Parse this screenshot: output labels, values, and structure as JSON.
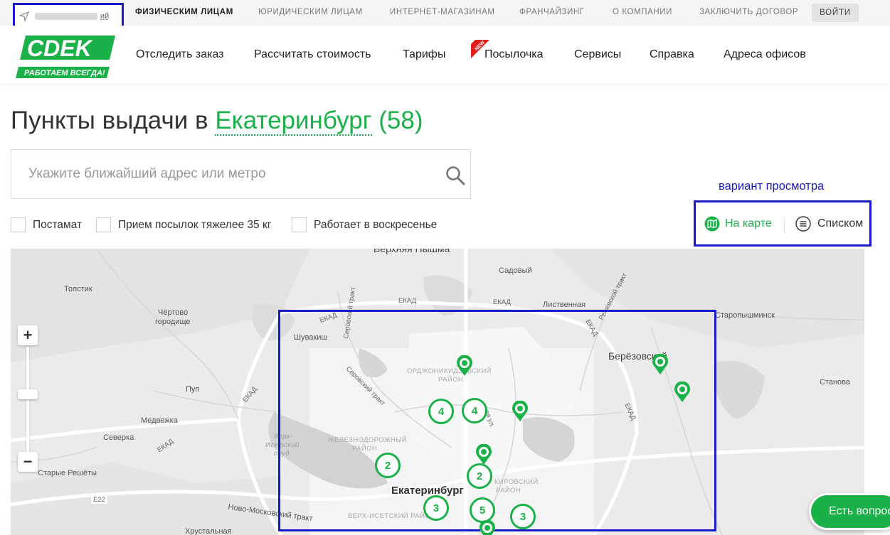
{
  "topbar": {
    "city_suffix": "ий",
    "nav": [
      "ФИЗИЧЕСКИМ ЛИЦАМ",
      "ЮРИДИЧЕСКИМ ЛИЦАМ",
      "ИНТЕРНЕТ-МАГАЗИНАМ",
      "ФРАНЧАЙЗИНГ",
      "О КОМПАНИИ",
      "ЗАКЛЮЧИТЬ ДОГОВОР"
    ],
    "login": "ВОЙТИ"
  },
  "logo": {
    "brand": "CDEK",
    "slogan": "РАБОТАЕМ ВСЕГДА!"
  },
  "main_nav": [
    "Отследить заказ",
    "Рассчитать стоимость",
    "Тарифы",
    "Посылочка",
    "Сервисы",
    "Справка",
    "Адреса офисов"
  ],
  "new_badge": "NEW",
  "page": {
    "title_prefix": "Пункты выдачи в",
    "city": "Екатеринбург",
    "count": "(58)"
  },
  "search": {
    "placeholder": "Укажите ближайший адрес или метро"
  },
  "filters": [
    "Постамат",
    "Прием посылок тяжелее 35 кг",
    "Работает в воскресенье"
  ],
  "view": {
    "label": "вариант просмотра",
    "map": "На карте",
    "list": "Списком"
  },
  "map": {
    "labels": {
      "verkhnyaya_pyshma": "Верхняя Пышма",
      "sadovy": "Садовый",
      "tolstik": "Толстик",
      "chertovo": "Чёртово",
      "gorodishche": "городище",
      "shuvakish": "Шувакиш",
      "staropyshminsk": "Старопышминск",
      "berezovsky": "Берёзовский",
      "stanova": "Станова",
      "pup": "Пуп",
      "medvezhka": "Медвежка",
      "severka": "Северка",
      "starye_reshety": "Старые Решёты",
      "ekaterinburg": "Екатеринбург",
      "listvennaya": "Лиственная",
      "e22": "E22",
      "novomoskovsky": "Ново-Московский тракт",
      "khrustalnaya": "Хрустальная",
      "ordzhonikidzevsky": "ОРДЖОНИКИДЗЕВСКИЙ",
      "rayon": "РАЙОН",
      "zheleznodorozhny": "ЖЕЛЕЗНОДОРОЖНЫЙ",
      "kirovsky": "КИРОВСКИЙ",
      "verkh_isetsky_district": "ВЕРХ-ИСЕТСКИЙ РАЙОН",
      "verkh_isetsky_pond_1": "Верх-",
      "verkh_isetsky_pond_2": "Исетский",
      "verkh_isetsky_pond_3": "пруд",
      "ekad": "ЕКАД",
      "serovsky": "Серовский тракт",
      "rezhevskoy": "Режевской тракт",
      "street_fragment": "ая ул."
    },
    "clusters": [
      "4",
      "4",
      "2",
      "2",
      "3",
      "5",
      "3"
    ],
    "zoom_in": "+",
    "zoom_out": "−"
  },
  "chat": {
    "label": "Есть вопрос"
  },
  "colors": {
    "brand_green": "#1ab248",
    "annotation_blue": "#1a1ac8"
  }
}
